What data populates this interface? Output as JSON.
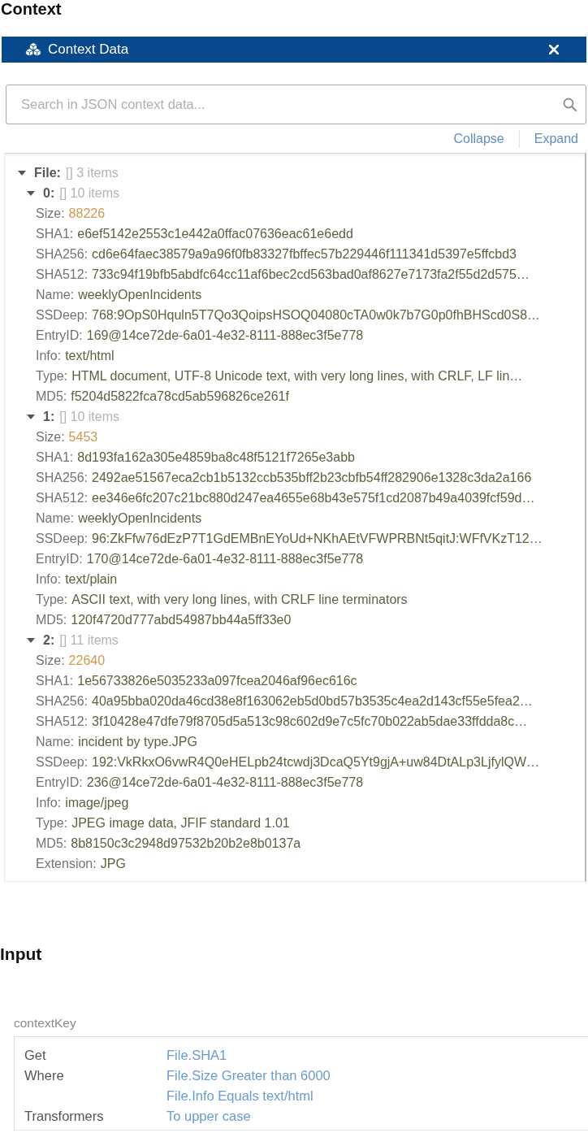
{
  "page_title": "Context",
  "context_panel": {
    "title": "Context Data",
    "search": {
      "placeholder": "Search in JSON context data..."
    },
    "actions": [
      "Collapse",
      "Expand"
    ]
  },
  "tree": [
    {
      "kind": "array",
      "key": "File:",
      "summary": "[] 3 items",
      "expanded": true,
      "children": [
        {
          "kind": "array",
          "key": "0:",
          "summary": "[] 10 items",
          "expanded": true,
          "children": [
            {
              "kind": "number",
              "key": "Size:",
              "value": "88226"
            },
            {
              "kind": "string",
              "key": "SHA1:",
              "value": "e6ef5142e2553c1e442a0ffac07636eac61e6edd"
            },
            {
              "kind": "string",
              "key": "SHA256:",
              "value": "cd6e64faec38579a9a96f0fb83327fbffec57b229446f111341d5397e5ffcbd3"
            },
            {
              "kind": "string",
              "key": "SHA512:",
              "value": "733c94f19bfb5abdfc64cc11af6bec2cd563bad0af8627e7173fa2f55d2d575…"
            },
            {
              "kind": "string",
              "key": "Name:",
              "value": "weeklyOpenIncidents"
            },
            {
              "kind": "string",
              "key": "SSDeep:",
              "value": "768:9OpS0Hquln5T7Qo3QoipsHSOQ04080cTA0w0k7b7G0p0fhBHScd0S8…"
            },
            {
              "kind": "string",
              "key": "EntryID:",
              "value": "169@14ce72de-6a01-4e32-8111-888ec3f5e778"
            },
            {
              "kind": "string",
              "key": "Info:",
              "value": "text/html"
            },
            {
              "kind": "string",
              "key": "Type:",
              "value": "HTML document, UTF-8 Unicode text, with very long lines, with CRLF, LF lin…"
            },
            {
              "kind": "string",
              "key": "MD5:",
              "value": "f5204d5822fca78cd5ab596826ce261f"
            }
          ]
        },
        {
          "kind": "array",
          "key": "1:",
          "summary": "[] 10 items",
          "expanded": true,
          "children": [
            {
              "kind": "number",
              "key": "Size:",
              "value": "5453"
            },
            {
              "kind": "string",
              "key": "SHA1:",
              "value": "8d193fa162a305e4859ba8c48f5121f7265e3abb"
            },
            {
              "kind": "string",
              "key": "SHA256:",
              "value": "2492ae51567eca2cb1b5132ccb535bff2b23cbfb54ff282906e1328c3da2a166"
            },
            {
              "kind": "string",
              "key": "SHA512:",
              "value": "ee346e6fc207c21bc880d247ea4655e68b43e575f1cd2087b49a4039fcf59d…"
            },
            {
              "kind": "string",
              "key": "Name:",
              "value": "weeklyOpenIncidents"
            },
            {
              "kind": "string",
              "key": "SSDeep:",
              "value": "96:ZkFfw76dEzP7T1GdEMBnEYoUd+NKhAEtVFWPRBNt5qitJ:WFfVKzT12…"
            },
            {
              "kind": "string",
              "key": "EntryID:",
              "value": "170@14ce72de-6a01-4e32-8111-888ec3f5e778"
            },
            {
              "kind": "string",
              "key": "Info:",
              "value": "text/plain"
            },
            {
              "kind": "string",
              "key": "Type:",
              "value": "ASCII text, with very long lines, with CRLF line terminators"
            },
            {
              "kind": "string",
              "key": "MD5:",
              "value": "120f4720d777abd54987bb44a5ff33e0"
            }
          ]
        },
        {
          "kind": "array",
          "key": "2:",
          "summary": "[] 11 items",
          "expanded": true,
          "children": [
            {
              "kind": "number",
              "key": "Size:",
              "value": "22640"
            },
            {
              "kind": "string",
              "key": "SHA1:",
              "value": "1e56733826e5035233a097fcea2046af96ec616c"
            },
            {
              "kind": "string",
              "key": "SHA256:",
              "value": "40a95bba020da46cd38e8f163062eb5d0bd57b3535c4ea2d143cf55e5fea2…"
            },
            {
              "kind": "string",
              "key": "SHA512:",
              "value": "3f10428e47dfe79f8705d5a513c98c602d9e7c5fc70b022ab5dae33ffdda8c…"
            },
            {
              "kind": "string",
              "key": "Name:",
              "value": "incident by type.JPG"
            },
            {
              "kind": "string",
              "key": "SSDeep:",
              "value": "192:VkRkxO6vwR4Q0eHELpb24tcwdj3DcaQ5Yt9gjA+uw84DtALp3LjfylQW…"
            },
            {
              "kind": "string",
              "key": "EntryID:",
              "value": "236@14ce72de-6a01-4e32-8111-888ec3f5e778"
            },
            {
              "kind": "string",
              "key": "Info:",
              "value": "image/jpeg"
            },
            {
              "kind": "string",
              "key": "Type:",
              "value": "JPEG image data, JFIF standard 1.01"
            },
            {
              "kind": "string",
              "key": "MD5:",
              "value": "8b8150c3c2948d97532b20b2e8b0137a"
            },
            {
              "kind": "string",
              "key": "Extension:",
              "value": "JPG"
            }
          ]
        }
      ]
    }
  ],
  "input_title": "Input",
  "input": {
    "label": "contextKey",
    "rows": [
      {
        "label": "Get",
        "values": [
          "File.SHA1"
        ]
      },
      {
        "label": "Where",
        "values": [
          "File.Size Greater than 6000",
          "File.Info Equals text/html"
        ]
      },
      {
        "label": "Transformers",
        "values": [
          "To upper case"
        ]
      }
    ]
  }
}
